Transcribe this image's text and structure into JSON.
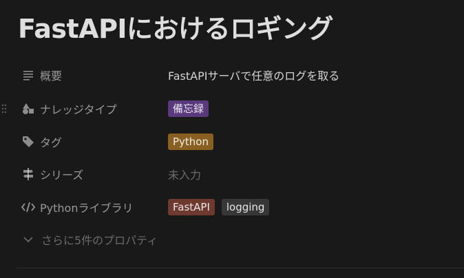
{
  "page": {
    "title": "FastAPIにおけるロギング"
  },
  "properties": [
    {
      "label": "概要",
      "icon": "text-lines-icon",
      "value": "FastAPIサーバで任意のログを取る"
    },
    {
      "label": "ナレッジタイプ",
      "icon": "shapes-icon",
      "tags": [
        {
          "text": "備忘録",
          "color": "#5a3a7e"
        }
      ]
    },
    {
      "label": "タグ",
      "icon": "tag-icon",
      "tags": [
        {
          "text": "Python",
          "color": "#8a6022"
        }
      ]
    },
    {
      "label": "シリーズ",
      "icon": "signpost-icon",
      "empty_text": "未入力"
    },
    {
      "label": "Pythonライブラリ",
      "icon": "code-icon",
      "tags": [
        {
          "text": "FastAPI",
          "color": "#6e3a30"
        },
        {
          "text": "logging",
          "color": "#373737"
        }
      ]
    }
  ],
  "more": {
    "label": "さらに5件のプロパティ",
    "icon": "chevron-down-icon"
  }
}
